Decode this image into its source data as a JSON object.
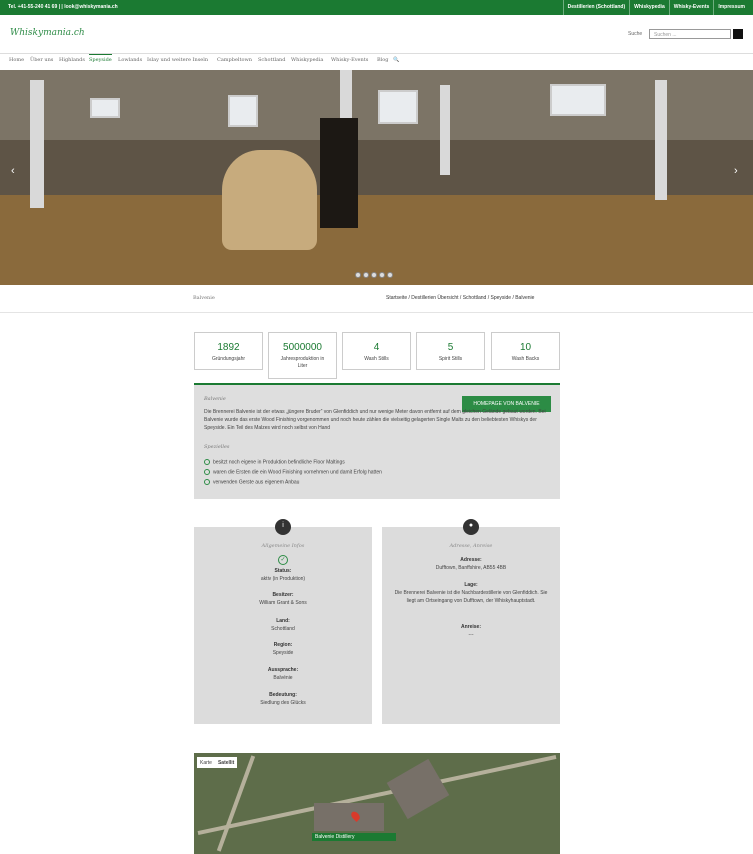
{
  "topbar": {
    "contact": "Tel. +41-55-240 41 69 | | look@whiskymania.ch",
    "links": [
      "Destillerien (Schottland)",
      "Whiskypedia",
      "Whisky-Events",
      "Impressum"
    ]
  },
  "header": {
    "logo": "Whiskymania.ch",
    "search_label": "Suche",
    "search_placeholder": "Suchen ..."
  },
  "nav": {
    "items": [
      "Home",
      "Über uns",
      "Highlands",
      "Speyside",
      "Lowlands",
      "Islay und weitere Inseln",
      "Campbeltown",
      "Schottland",
      "Whiskypedia",
      "Whisky-Events",
      "Blog"
    ],
    "active": "Speyside"
  },
  "slider": {
    "prev": "‹",
    "next": "›",
    "dot_count": 5
  },
  "breadcrumb": {
    "page_name": "Balvenie",
    "path": "Startseite / Destillerien Übersicht / Schottland / Speyside / Balvenie"
  },
  "stats": [
    {
      "value": "1892",
      "label": "Gründungsjahr"
    },
    {
      "value": "5000000",
      "label": "Jahresproduktion in Liter"
    },
    {
      "value": "4",
      "label": "Wash Stills"
    },
    {
      "value": "5",
      "label": "Spirit Stills"
    },
    {
      "value": "10",
      "label": "Wash Backs"
    }
  ],
  "info": {
    "heading": "Balvenie",
    "homepage_button": "HOMEPAGE VON BALVENIE",
    "text": "Die Brennerei Balvenie ist der etwas „jüngere Bruder“ von Glenfiddich und nur wenige Meter davon entfernt auf dem gleichen Gelände gebaut worden. Bei Balvenie wurde das erste Wood Finishing vorgenommen und noch heute zählen die vielseitig gelagerten Single Malts zu den beliebtesten Whiskys der Speyside. Ein Teil des Malzes wird noch selbst von Hand",
    "special_heading": "Spezielles",
    "specials": [
      "besitzt noch eigene in Produktion befindliche Floor Maltings",
      "waren die Ersten die ein Wood Finishing vornehmen und damit Erfolg hatten",
      "verwenden Gerste aus eigenem Anbau"
    ]
  },
  "general": {
    "icon": "info-icon",
    "title": "Allgemeine Infos",
    "status_label": "Status:",
    "status_value": "aktiv (in Produktion)",
    "owner_label": "Besitzer:",
    "owner_value": "William Grant & Sons",
    "country_label": "Land:",
    "country_value": "Schottland",
    "region_label": "Region:",
    "region_value": "Speyside",
    "pronunciation_label": "Aussprache:",
    "pronunciation_value": "Balvénie",
    "meaning_label": "Bedeutung:",
    "meaning_value": "Siedlung des Glücks"
  },
  "address": {
    "icon": "car-icon",
    "title": "Adresse, Anreise",
    "address_label": "Adresse:",
    "address_value": "Dufftown, Banffshire, AB55 4BB",
    "location_label": "Lage:",
    "location_value": "Die Brennerei Balvenie ist die Nachbardestillerie von Glenfiddich. Sie liegt am Ortseingang von Dufftown, der Whiskyhauptstadt.",
    "travel_label": "Anreise:",
    "travel_value": "---"
  },
  "map": {
    "toggle_map": "Karte",
    "toggle_satellite": "Satellit",
    "marker_label": "Balvenie Distillery"
  },
  "colors": {
    "brand_green": "#1b7a32",
    "button_green": "#2c8c45"
  }
}
